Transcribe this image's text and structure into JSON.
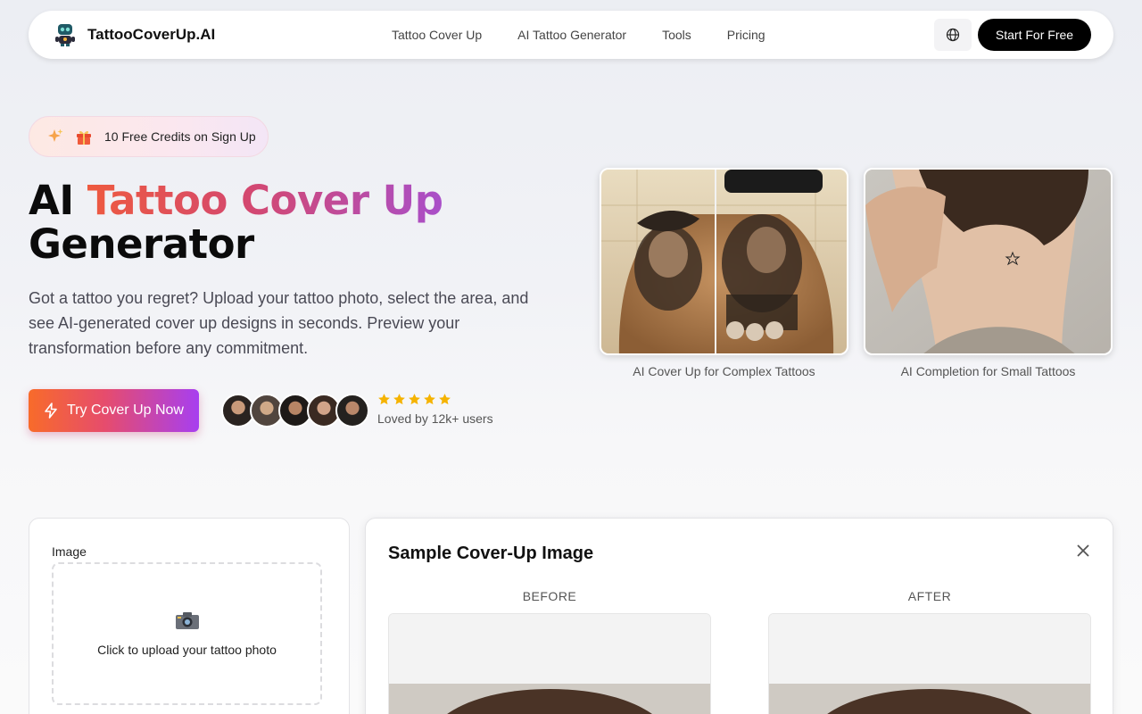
{
  "header": {
    "brand": "TattooCoverUp.AI",
    "nav": [
      "Tattoo Cover Up",
      "AI Tattoo Generator",
      "Tools",
      "Pricing"
    ],
    "cta": "Start For Free"
  },
  "hero": {
    "badge": "10 Free Credits on Sign Up",
    "title_pre": "AI ",
    "title_grad": "Tattoo Cover Up",
    "title_post": "Generator",
    "subtitle": "Got a tattoo you regret? Upload your tattoo photo, select the area, and see AI-generated cover up designs in seconds. Preview your transformation before any commitment.",
    "cta": "Try Cover Up Now",
    "rating_stars": 5,
    "social_proof": "Loved by 12k+ users"
  },
  "showcase": [
    {
      "caption": "AI Cover Up for Complex Tattoos"
    },
    {
      "caption": "AI Completion for Small Tattoos"
    }
  ],
  "upload": {
    "label": "Image",
    "hint": "Click to upload your tattoo photo"
  },
  "sample": {
    "title": "Sample Cover-Up Image",
    "before_label": "BEFORE",
    "after_label": "AFTER"
  },
  "colors": {
    "gradient_start": "#f86b2a",
    "gradient_mid": "#e64c6d",
    "gradient_end": "#a73ff0",
    "star": "#f5b301"
  }
}
